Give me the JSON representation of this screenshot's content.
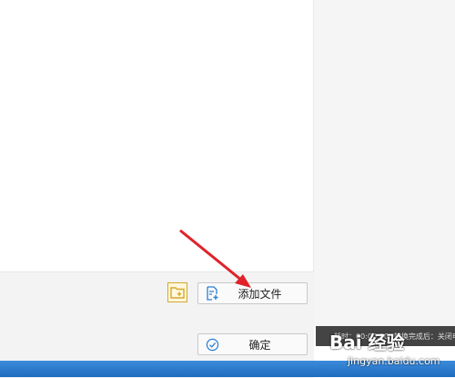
{
  "buttons": {
    "add_file_label": "添加文件",
    "confirm_label": "确定"
  },
  "status": {
    "elapsed": "耗时：00:00:00",
    "after_convert": "转换完成后：关闭电"
  },
  "watermark": {
    "logo": "Bai 经验",
    "url": "jingyan.baidu.com"
  },
  "colors": {
    "accent_blue": "#2a7fd4",
    "folder_yellow": "#d4a92b",
    "arrow_red": "#e0222a"
  },
  "icons": {
    "folder": "folder-add-icon",
    "add_file": "file-add-icon",
    "confirm": "check-circle-icon"
  }
}
